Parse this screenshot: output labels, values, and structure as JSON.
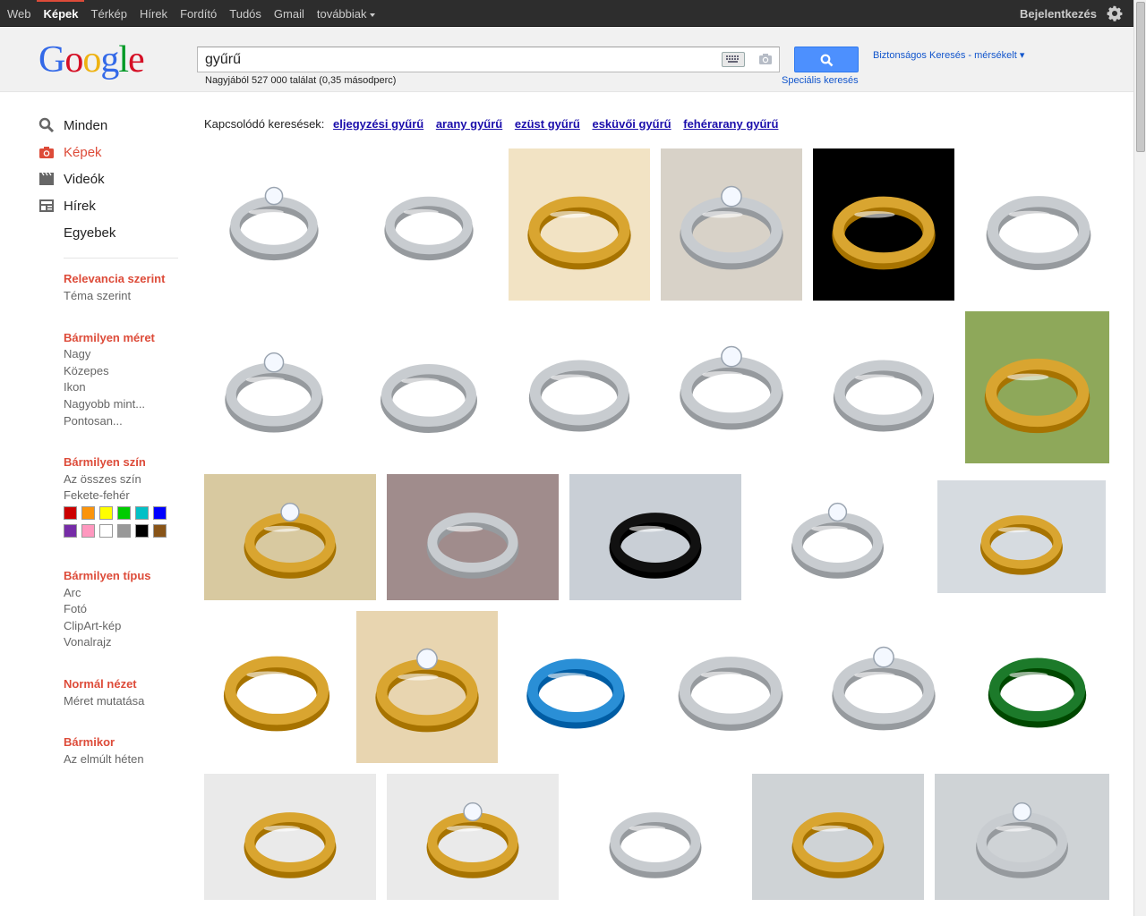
{
  "topnav": {
    "items": [
      {
        "label": "Web",
        "active": false
      },
      {
        "label": "Képek",
        "active": true
      },
      {
        "label": "Térkép",
        "active": false
      },
      {
        "label": "Hírek",
        "active": false
      },
      {
        "label": "Fordító",
        "active": false
      },
      {
        "label": "Tudós",
        "active": false
      },
      {
        "label": "Gmail",
        "active": false
      },
      {
        "label": "továbbiak",
        "active": false
      }
    ],
    "signin": "Bejelentkezés",
    "settings_icon": "gear-icon"
  },
  "header": {
    "logo": "Google",
    "query": "gyűrű",
    "result_count": "Nagyjából 527 000 találat (0,35 másodperc)",
    "advanced_search": "Speciális keresés",
    "safesearch": "Biztonságos Keresés - mérsékelt ▾"
  },
  "leftnav": {
    "verticals": [
      {
        "label": "Minden",
        "icon": "search-icon",
        "active": false
      },
      {
        "label": "Képek",
        "icon": "camera-icon",
        "active": true
      },
      {
        "label": "Videók",
        "icon": "film-icon",
        "active": false
      },
      {
        "label": "Hírek",
        "icon": "news-icon",
        "active": false
      },
      {
        "label": "Egyebek",
        "icon": "",
        "active": false
      }
    ],
    "filters": {
      "sort": {
        "selected": "Relevancia szerint",
        "options": [
          "Téma szerint"
        ]
      },
      "size": {
        "selected": "Bármilyen méret",
        "options": [
          "Nagy",
          "Közepes",
          "Ikon",
          "Nagyobb mint...",
          "Pontosan..."
        ]
      },
      "color": {
        "selected": "Bármilyen szín",
        "options": [
          "Az összes szín",
          "Fekete-fehér"
        ],
        "swatches": [
          "#cc0000",
          "#fb940b",
          "#ffff00",
          "#00cc00",
          "#03c0c6",
          "#0000ff",
          "#762ca7",
          "#ff98bf",
          "#ffffff",
          "#999999",
          "#000000",
          "#885418"
        ]
      },
      "type": {
        "selected": "Bármilyen típus",
        "options": [
          "Arc",
          "Fotó",
          "ClipArt-kép",
          "Vonalrajz"
        ]
      },
      "view": {
        "selected": "Normál nézet",
        "options": [
          "Méret mutatása"
        ]
      },
      "time": {
        "selected": "Bármikor",
        "options": [
          "Az elmúlt héten"
        ]
      }
    }
  },
  "related": {
    "label": "Kapcsolódó keresések:",
    "links": [
      "eljegyzési gyűrű",
      "arany gyűrű",
      "ezüst gyűrű",
      "esküvői gyűrű",
      "fehérarany gyűrű"
    ]
  },
  "results": {
    "colors": {
      "silver": "#c8ccd0",
      "gold": "#d9a530",
      "black": "#111111",
      "blue": "#2a8fd6",
      "green": "#1c7a2a"
    }
  }
}
